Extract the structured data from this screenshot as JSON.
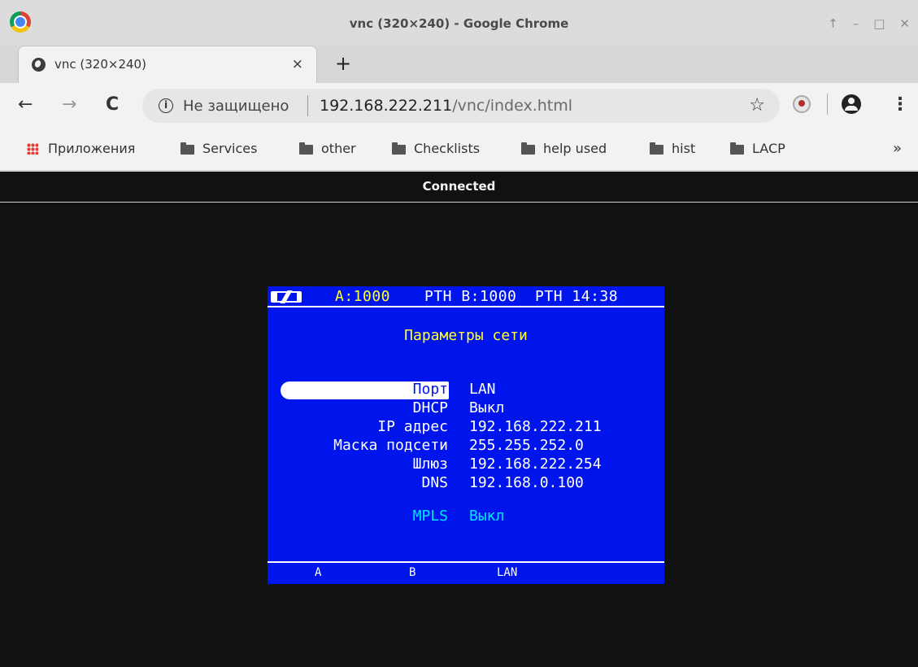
{
  "window": {
    "title": "vnc (320×240) - Google Chrome",
    "controls": [
      "↑",
      "–",
      "□",
      "✕"
    ]
  },
  "tab": {
    "title": "vnc (320×240)",
    "close": "×",
    "new_tab": "+"
  },
  "toolbar": {
    "back": "←",
    "forward": "→",
    "reload": "C",
    "security_label": "Не защищено",
    "url_host": "192.168.222.211",
    "url_path": "/vnc/index.html",
    "star": "☆",
    "menu": "⋮"
  },
  "bookmarks": {
    "apps_label": "Приложения",
    "items": [
      "Services",
      "other",
      "Checklists",
      "help used",
      "hist",
      "LACP"
    ],
    "more": "»"
  },
  "vnc": {
    "status": "Connected"
  },
  "device": {
    "header_a": "A:1000",
    "header_rest": "PTH B:1000  PTH 14:38",
    "title": "Параметры сети",
    "rows": [
      {
        "label": "Порт",
        "value": "LAN"
      },
      {
        "label": "DHCP",
        "value": "Выкл"
      },
      {
        "label": "IP адрес",
        "value": "192.168.222.211"
      },
      {
        "label": "Маска подсети",
        "value": "255.255.252.0"
      },
      {
        "label": "Шлюз",
        "value": "192.168.222.254"
      },
      {
        "label": "DNS",
        "value": "192.168.0.100"
      },
      {
        "label": "MPLS",
        "value": "Выкл"
      }
    ],
    "softkeys": [
      "A",
      "B",
      "LAN"
    ]
  }
}
